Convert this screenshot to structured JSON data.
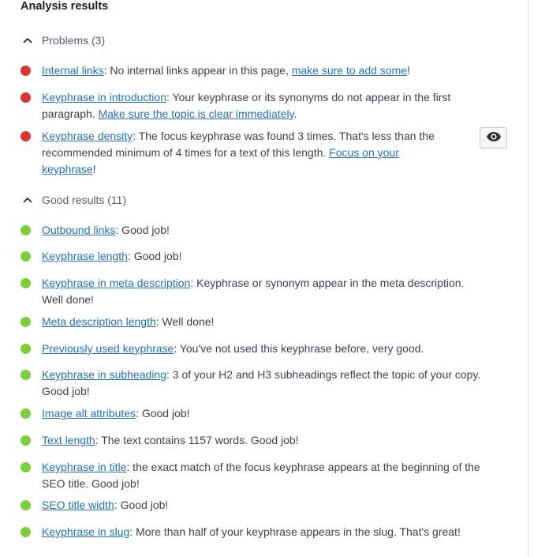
{
  "panel": {
    "title": "Analysis results"
  },
  "colors": {
    "problem": "#dc3232",
    "good": "#7ad03a",
    "link": "#2271b1"
  },
  "problems": {
    "header": "Problems (3)",
    "expanded": true,
    "items": [
      {
        "link": "Internal links",
        "text": ": No internal links appear in this page, ",
        "link2": "make sure to add some",
        "text2": "!"
      },
      {
        "link": "Keyphrase in introduction",
        "text": ": Your keyphrase or its synonyms do not appear in the first paragraph. ",
        "link2": "Make sure the topic is clear immediately",
        "text2": "."
      },
      {
        "link": "Keyphrase density",
        "text": ": The focus keyphrase was found 3 times. That's less than the recommended minimum of 4 times for a text of this length. ",
        "link2": "Focus on your keyphrase",
        "text2": "!"
      }
    ],
    "highlight_button_icon": "eye-icon"
  },
  "good_results": {
    "header": "Good results (11)",
    "expanded": true,
    "items": [
      {
        "link": "Outbound links",
        "text": ": Good job!"
      },
      {
        "link": "Keyphrase length",
        "text": ": Good job!"
      },
      {
        "link": "Keyphrase in meta description",
        "text": ": Keyphrase or synonym appear in the meta description. Well done!"
      },
      {
        "link": "Meta description length",
        "text": ": Well done!"
      },
      {
        "link": "Previously used keyphrase",
        "text": ": You've not used this keyphrase before, very good."
      },
      {
        "link": "Keyphrase in subheading",
        "text": ": 3 of your H2 and H3 subheadings reflect the topic of your copy. Good job!"
      },
      {
        "link": "Image alt attributes",
        "text": ": Good job!"
      },
      {
        "link": "Text length",
        "text": ": The text contains 1157 words. Good job!"
      },
      {
        "link": "Keyphrase in title",
        "text": ": the exact match of the focus keyphrase appears at the beginning of the SEO title. Good job!"
      },
      {
        "link": "SEO title width",
        "text": ": Good job!"
      },
      {
        "link": "Keyphrase in slug",
        "text": ": More than half of your keyphrase appears in the slug. That's great!"
      }
    ]
  }
}
